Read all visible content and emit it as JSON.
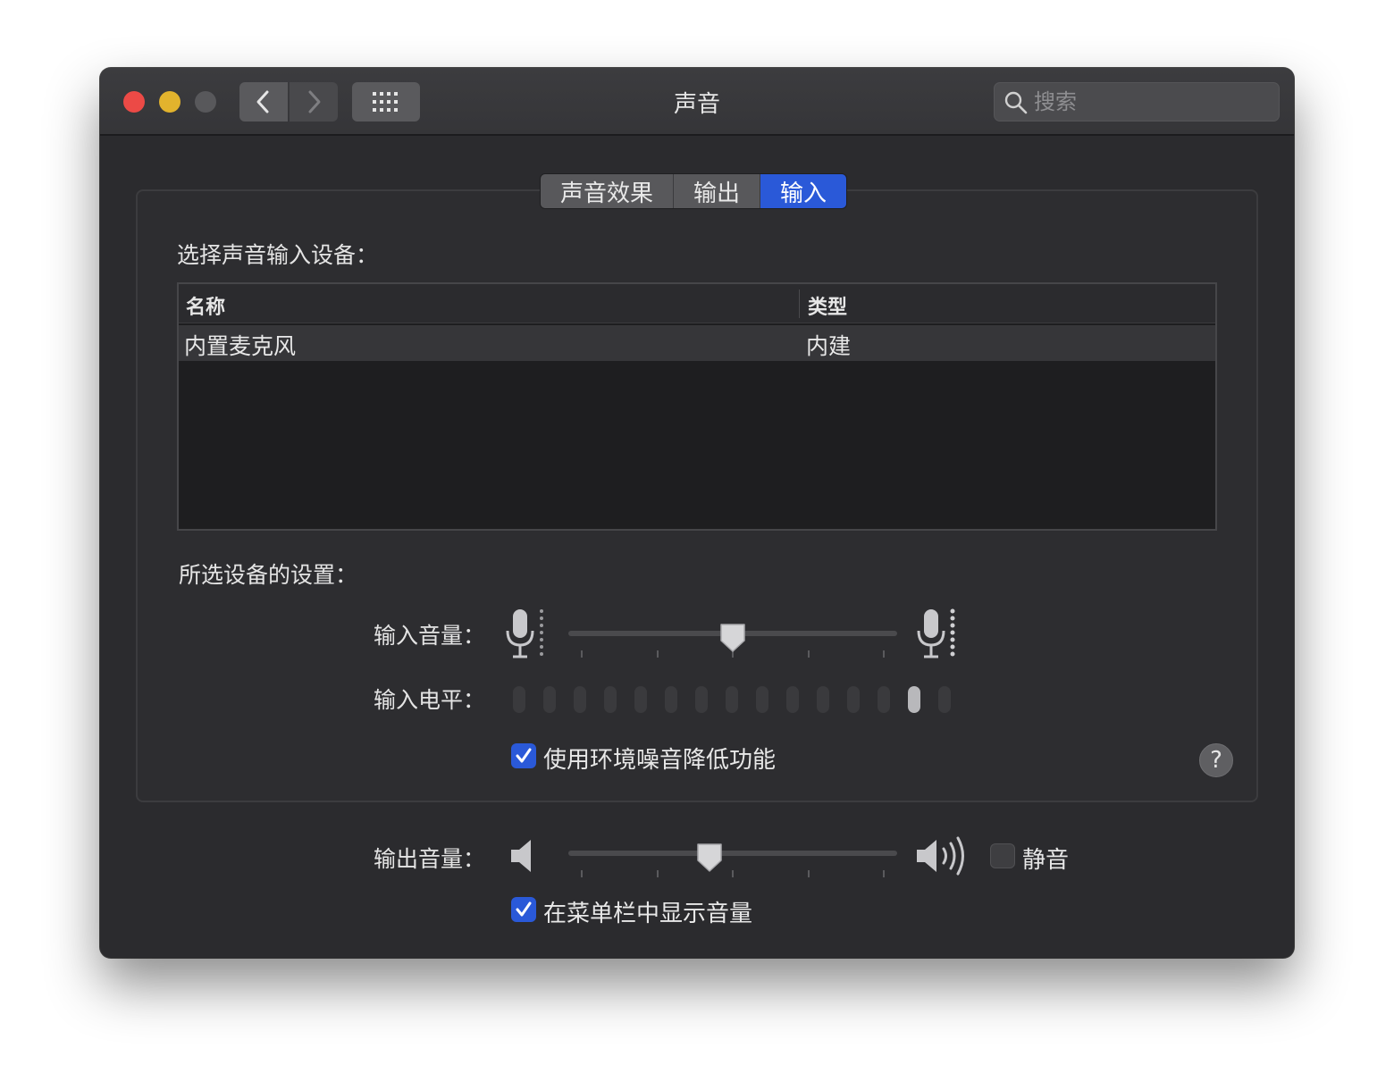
{
  "window": {
    "title": "声音"
  },
  "search": {
    "placeholder": "搜索"
  },
  "tabs": [
    {
      "label": "声音效果",
      "active": false
    },
    {
      "label": "输出",
      "active": false
    },
    {
      "label": "输入",
      "active": true
    }
  ],
  "input_device": {
    "heading": "选择声音输入设备：",
    "columns": [
      "名称",
      "类型"
    ],
    "rows": [
      {
        "name": "内置麦克风",
        "type": "内建"
      }
    ]
  },
  "settings": {
    "heading": "所选设备的设置：",
    "input_volume_label": "输入音量：",
    "input_volume_value": 0.5,
    "input_level_label": "输入电平：",
    "input_level_segments": 15,
    "input_level_active_index": 13,
    "noise_reduction_label": "使用环境噪音降低功能",
    "noise_reduction_checked": true
  },
  "output": {
    "volume_label": "输出音量：",
    "volume_value": 0.43,
    "mute_label": "静音",
    "mute_checked": false,
    "show_in_menubar_label": "在菜单栏中显示音量",
    "show_in_menubar_checked": true
  },
  "icons": {
    "back": "chevron-left-icon",
    "forward": "chevron-right-icon",
    "grid": "grid-icon",
    "search": "search-icon",
    "mic_low": "microphone-low-icon",
    "mic_high": "microphone-high-icon",
    "speaker_low": "speaker-low-icon",
    "speaker_high": "speaker-high-icon",
    "check": "checkmark-icon",
    "help": "help-icon"
  },
  "colors": {
    "accent": "#2a59d8",
    "close": "#ec4a46",
    "minimize": "#e2b32d",
    "zoom_disabled": "#58585b",
    "window_bg": "#2b2b2e"
  }
}
